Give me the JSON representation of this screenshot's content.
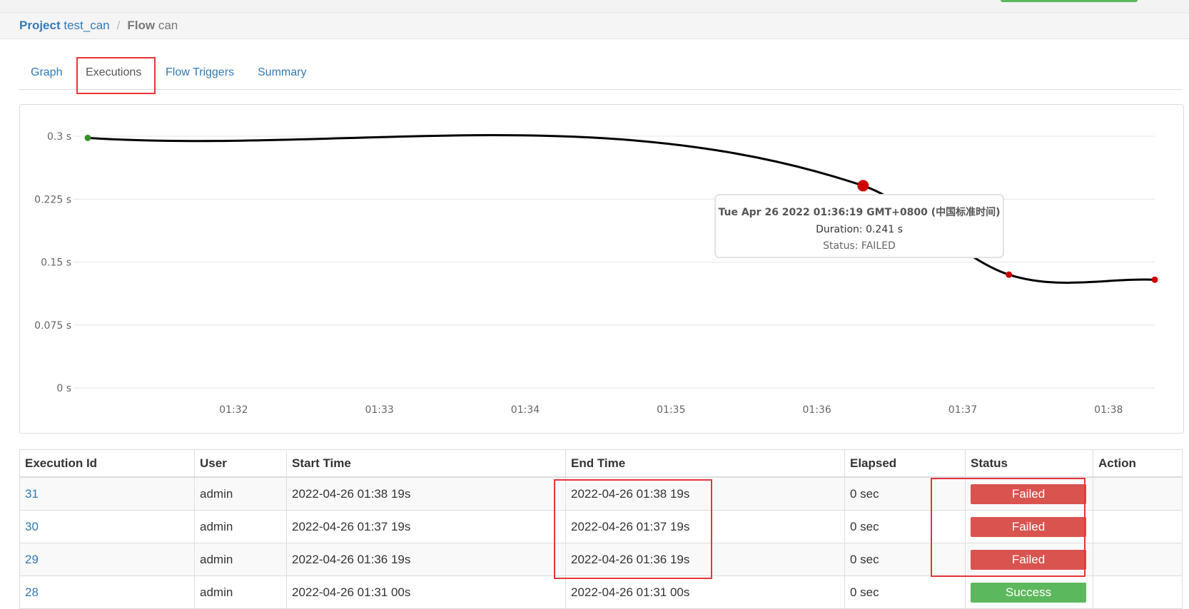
{
  "breadcrumb": {
    "project_label": "Project",
    "project_name": "test_can",
    "separator": "/",
    "flow_label": "Flow",
    "flow_name": "can"
  },
  "tabs": [
    {
      "label": "Graph",
      "active": false
    },
    {
      "label": "Executions",
      "active": true
    },
    {
      "label": "Flow Triggers",
      "active": false
    },
    {
      "label": "Summary",
      "active": false
    }
  ],
  "chart_data": {
    "type": "line",
    "title": "",
    "xlabel": "",
    "ylabel": "",
    "x_ticks": [
      "01:32",
      "01:33",
      "01:34",
      "01:35",
      "01:36",
      "01:37",
      "01:38"
    ],
    "y_ticks": [
      "0 s",
      "0.075 s",
      "0.15 s",
      "0.225 s",
      "0.3 s"
    ],
    "ylim": [
      0,
      0.3
    ],
    "grid": true,
    "series": [
      {
        "points": [
          {
            "x": "01:31:00",
            "y": 0.298,
            "status": "SUCCEEDED"
          },
          {
            "x": "01:36:19",
            "y": 0.241,
            "status": "FAILED"
          },
          {
            "x": "01:37:19",
            "y": 0.135,
            "status": "FAILED"
          },
          {
            "x": "01:38:19",
            "y": 0.129,
            "status": "FAILED"
          }
        ]
      }
    ],
    "tooltip": {
      "title": "Tue Apr 26 2022 01:36:19 GMT+0800 (中国标准时间)",
      "duration": "Duration: 0.241 s",
      "status": "Status: FAILED"
    },
    "colors": {
      "line": "#000000",
      "success": "#3a8f2b",
      "failed": "#cc0000",
      "grid": "#e6e6e6"
    }
  },
  "table": {
    "headers": [
      "Execution Id",
      "User",
      "Start Time",
      "End Time",
      "Elapsed",
      "Status",
      "Action"
    ],
    "rows": [
      {
        "id": "31",
        "user": "admin",
        "start": "2022-04-26 01:38 19s",
        "end": "2022-04-26 01:38 19s",
        "elapsed": "0 sec",
        "status": "Failed"
      },
      {
        "id": "30",
        "user": "admin",
        "start": "2022-04-26 01:37 19s",
        "end": "2022-04-26 01:37 19s",
        "elapsed": "0 sec",
        "status": "Failed"
      },
      {
        "id": "29",
        "user": "admin",
        "start": "2022-04-26 01:36 19s",
        "end": "2022-04-26 01:36 19s",
        "elapsed": "0 sec",
        "status": "Failed"
      },
      {
        "id": "28",
        "user": "admin",
        "start": "2022-04-26 01:31 00s",
        "end": "2022-04-26 01:31 00s",
        "elapsed": "0 sec",
        "status": "Success"
      }
    ]
  },
  "colors": {
    "link": "#337ab7",
    "failed": "#d9534f",
    "success": "#5cb85c",
    "highlight": "#e8333a"
  }
}
